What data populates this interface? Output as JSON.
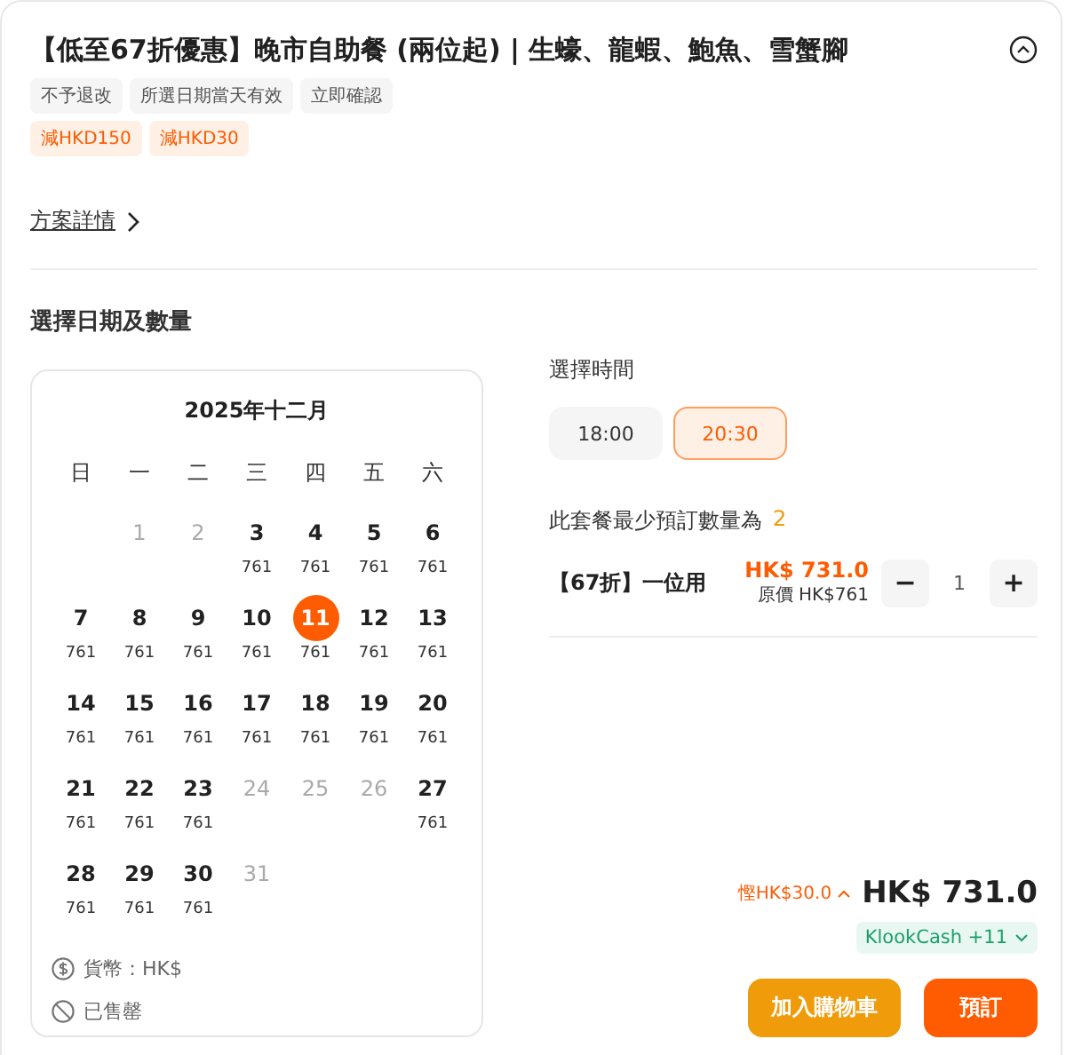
{
  "title": "【低至67折優惠】晚市自助餐 (兩位起) | 生蠔、龍蝦、鮑魚、雪蟹腳",
  "collapse_toggle": {
    "expanded": true
  },
  "tags": [
    "不予退改",
    "所選日期當天有效",
    "立即確認"
  ],
  "discounts": [
    "減HKD150",
    "減HKD30"
  ],
  "details_link": "方案詳情",
  "section_title": "選擇日期及數量",
  "calendar": {
    "month": "2025年十二月",
    "weekdays": [
      "日",
      "一",
      "二",
      "三",
      "四",
      "五",
      "六"
    ],
    "weeks": [
      [
        {
          "day": "1",
          "disabled": true,
          "selected": false
        },
        {
          "day": "2",
          "disabled": true,
          "selected": false
        },
        {
          "day": "3",
          "price": "761",
          "disabled": false,
          "selected": false
        },
        {
          "day": "4",
          "price": "761",
          "disabled": false,
          "selected": false
        },
        {
          "day": "5",
          "price": "761",
          "disabled": false,
          "selected": false
        },
        {
          "day": "6",
          "price": "761",
          "disabled": false,
          "selected": false
        }
      ],
      [
        {
          "day": "7",
          "price": "761",
          "disabled": false,
          "selected": false
        },
        {
          "day": "8",
          "price": "761",
          "disabled": false,
          "selected": false
        },
        {
          "day": "9",
          "price": "761",
          "disabled": false,
          "selected": false
        },
        {
          "day": "10",
          "price": "761",
          "disabled": false,
          "selected": false
        },
        {
          "day": "11",
          "price": "761",
          "disabled": false,
          "selected": true
        },
        {
          "day": "12",
          "price": "761",
          "disabled": false,
          "selected": false
        },
        {
          "day": "13",
          "price": "761",
          "disabled": false,
          "selected": false
        }
      ],
      [
        {
          "day": "14",
          "price": "761",
          "disabled": false,
          "selected": false
        },
        {
          "day": "15",
          "price": "761",
          "disabled": false,
          "selected": false
        },
        {
          "day": "16",
          "price": "761",
          "disabled": false,
          "selected": false
        },
        {
          "day": "17",
          "price": "761",
          "disabled": false,
          "selected": false
        },
        {
          "day": "18",
          "price": "761",
          "disabled": false,
          "selected": false
        },
        {
          "day": "19",
          "price": "761",
          "disabled": false,
          "selected": false
        },
        {
          "day": "20",
          "price": "761",
          "disabled": false,
          "selected": false
        }
      ],
      [
        {
          "day": "21",
          "price": "761",
          "disabled": false,
          "selected": false
        },
        {
          "day": "22",
          "price": "761",
          "disabled": false,
          "selected": false
        },
        {
          "day": "23",
          "price": "761",
          "disabled": false,
          "selected": false
        },
        {
          "day": "24",
          "disabled": true,
          "selected": false
        },
        {
          "day": "25",
          "disabled": true,
          "selected": false
        },
        {
          "day": "26",
          "disabled": true,
          "selected": false
        },
        {
          "day": "27",
          "price": "761",
          "disabled": false,
          "selected": false
        }
      ],
      [
        {
          "day": "28",
          "price": "761",
          "disabled": false,
          "selected": false
        },
        {
          "day": "29",
          "price": "761",
          "disabled": false,
          "selected": false
        },
        {
          "day": "30",
          "price": "761",
          "disabled": false,
          "selected": false
        },
        {
          "day": "31",
          "disabled": true,
          "selected": false
        }
      ]
    ],
    "legend": [
      {
        "kind": "currency",
        "label": "貨幣：HK$"
      },
      {
        "kind": "sold-out",
        "label": "已售罄"
      }
    ]
  },
  "time_label": "選擇時間",
  "times": [
    {
      "label": "18:00",
      "selected": false
    },
    {
      "label": "20:30",
      "selected": true
    }
  ],
  "min_qty_label": "此套餐最少預訂數量為",
  "min_qty": "2",
  "package": {
    "name": "【67折】一位用",
    "price": "HK$ 731.0",
    "original_price": "原價 HK$761",
    "minus": "−",
    "quantity": "1",
    "plus": "+"
  },
  "savings": "慳HK$30.0",
  "total": "HK$ 731.0",
  "klook_cash": "KlookCash +11",
  "buttons": [
    {
      "kind": "cart",
      "label": "加入購物車"
    },
    {
      "kind": "book",
      "label": "預訂"
    }
  ]
}
